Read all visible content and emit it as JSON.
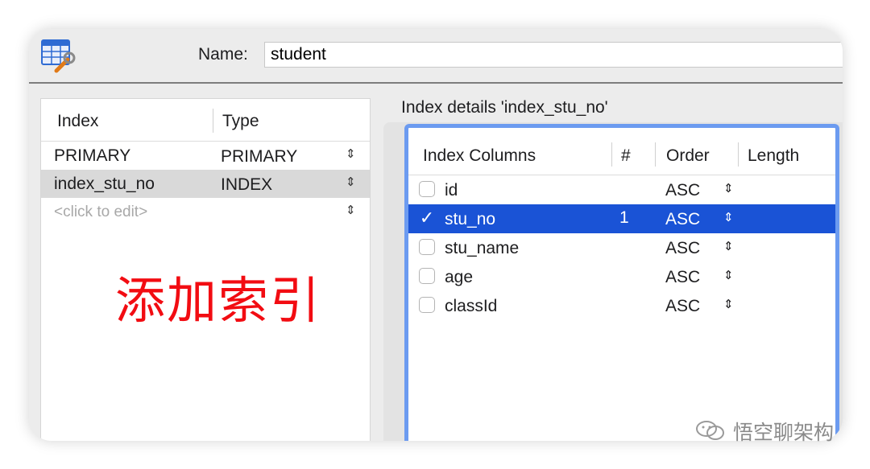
{
  "header": {
    "name_label": "Name:",
    "name_value": "student"
  },
  "index_list": {
    "columns": [
      "Index",
      "Type"
    ],
    "rows": [
      {
        "index": "PRIMARY",
        "type": "PRIMARY",
        "selected": false
      },
      {
        "index": "index_stu_no",
        "type": "INDEX",
        "selected": true
      },
      {
        "index": "<click to edit>",
        "type": "",
        "selected": false
      }
    ],
    "stepper_glyph": "⇕"
  },
  "annotation": {
    "text": "添加索引",
    "color": "#f20c12"
  },
  "details": {
    "title": "Index details 'index_stu_no'",
    "columns": [
      "Index Columns",
      "#",
      "Order",
      "Length"
    ],
    "rows": [
      {
        "name": "id",
        "checked": false,
        "position": "",
        "order": "ASC"
      },
      {
        "name": "stu_no",
        "checked": true,
        "position": "1",
        "order": "ASC"
      },
      {
        "name": "stu_name",
        "checked": false,
        "position": "",
        "order": "ASC"
      },
      {
        "name": "age",
        "checked": false,
        "position": "",
        "order": "ASC"
      },
      {
        "name": "classId",
        "checked": false,
        "position": "",
        "order": "ASC"
      }
    ],
    "selection_color": "#1a53d6",
    "focus_ring_color": "#6c9bf0"
  },
  "watermark": {
    "text": "悟空聊架构"
  }
}
